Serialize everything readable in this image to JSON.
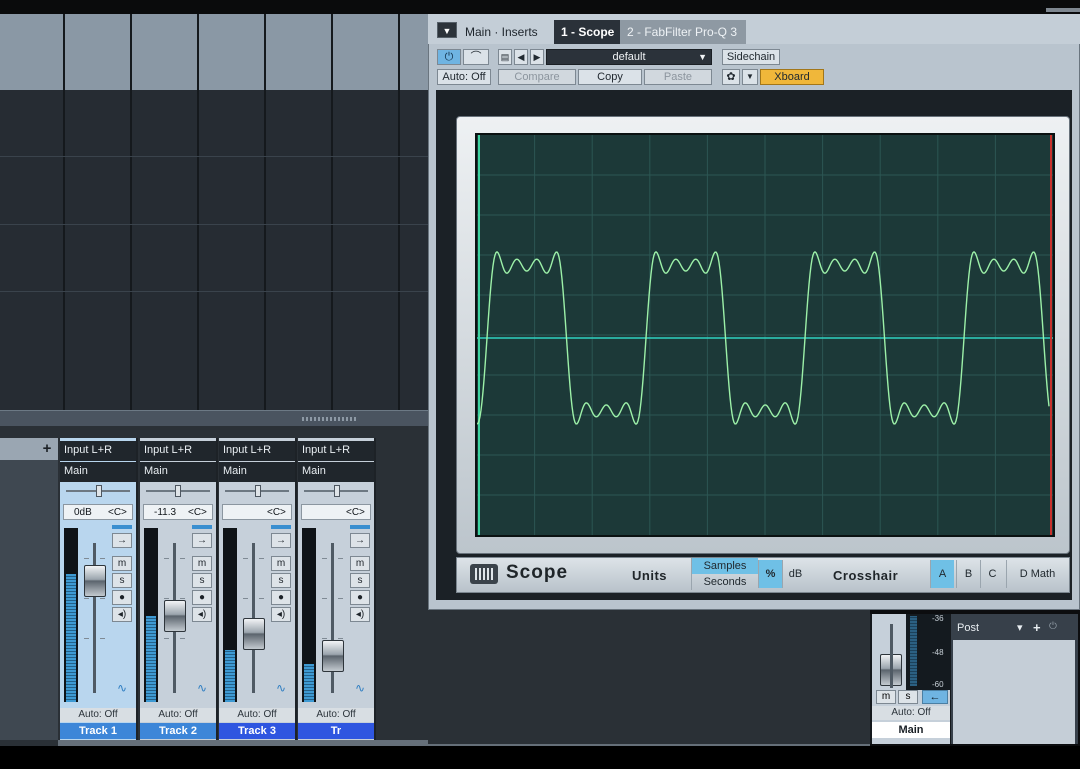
{
  "console": {
    "strips": [
      {
        "input": "Input L+R",
        "output": "Main",
        "volume": "0dB",
        "pan": "<C>",
        "automation": "Auto: Off",
        "name": "Track 1",
        "selected": true
      },
      {
        "input": "Input L+R",
        "output": "Main",
        "volume": "-11.3",
        "pan": "<C>",
        "automation": "Auto: Off",
        "name": "Track 2",
        "selected": false
      },
      {
        "input": "Input L+R",
        "output": "Main",
        "volume": "",
        "pan": "<C>",
        "automation": "Auto: Off",
        "name": "Track 3",
        "selected": false
      },
      {
        "input": "Input L+R",
        "output": "Main",
        "volume": "",
        "pan": "<C>",
        "automation": "Auto: Off",
        "name": "Tr",
        "selected": false
      }
    ],
    "button_glyphs": {
      "insert": "→",
      "mute": "m",
      "solo": "s",
      "record": "●",
      "monitor": "◂)",
      "wave": "∿"
    },
    "add_channel": "+"
  },
  "plugin": {
    "tabs": {
      "menu": "▼",
      "main": "Main · Inserts",
      "active": "1 - Scope",
      "other": "2 - FabFilter Pro-Q 3"
    },
    "toolbar": {
      "power": "⏻",
      "compare_icon": "⌒",
      "preset": "default",
      "sidechain": "Sidechain",
      "auto": "Auto: Off",
      "compare": "Compare",
      "copy": "Copy",
      "paste": "Paste",
      "settings": "✿",
      "xboard": "Xboard"
    },
    "scope": {
      "title": "Scope",
      "units_label": "Units",
      "samples": "Samples",
      "seconds": "Seconds",
      "percent": "%",
      "db": "dB",
      "crosshair": "Crosshair",
      "a": "A",
      "b": "B",
      "c": "C",
      "dmath": "D Math"
    }
  },
  "main_channel": {
    "mute": "m",
    "solo": "s",
    "back": "←",
    "automation": "Auto: Off",
    "name": "Main",
    "meter_labels": [
      "-36",
      "-48",
      "-60"
    ]
  },
  "post": {
    "label": "Post",
    "dropdown": "▾",
    "add": "+",
    "power": "⏻"
  }
}
